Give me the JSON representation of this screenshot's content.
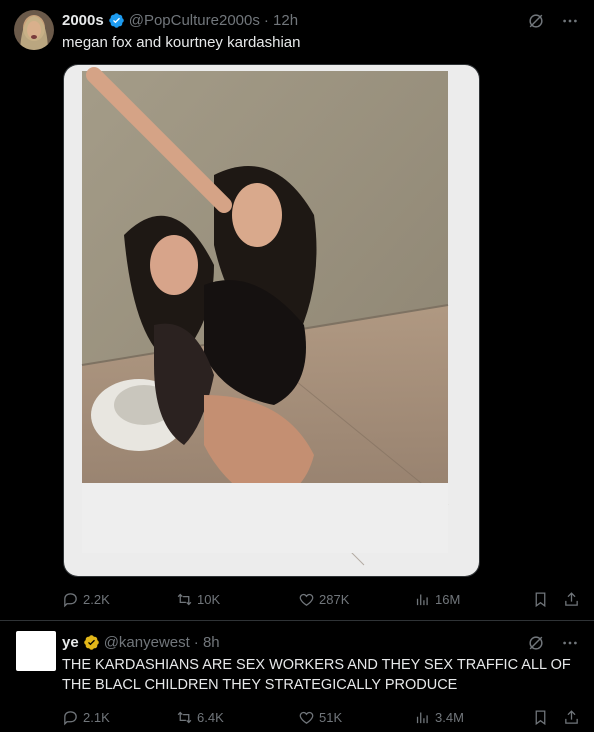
{
  "colors": {
    "background": "#000000",
    "text": "#e7e9ea",
    "muted": "#71767b",
    "verified": "#1d9bf0",
    "verified_gold": "#e2b719",
    "border": "#2f3336"
  },
  "posts": [
    {
      "author": "2000s",
      "handle": "@PopCulture2000s",
      "time": "· 12h",
      "text": "megan fox and kourtney kardashian",
      "badge": "verified-blue-icon",
      "media": "photo",
      "stats": {
        "replies": "2.2K",
        "reposts": "10K",
        "likes": "287K",
        "views": "16M"
      }
    },
    {
      "author": "ye",
      "handle": "@kanyewest",
      "time": "· 8h",
      "text": "THE KARDASHIANS ARE SEX WORKERS AND THEY SEX TRAFFIC ALL OF THE BLACL CHILDREN THEY STRATEGICALLY PRODUCE",
      "badge": "verified-gold-icon",
      "stats": {
        "replies": "2.1K",
        "reposts": "6.4K",
        "likes": "51K",
        "views": "3.4M"
      }
    }
  ],
  "icons": [
    "grok-icon",
    "more-icon",
    "reply-icon",
    "repost-icon",
    "like-icon",
    "views-icon",
    "bookmark-icon",
    "share-icon"
  ]
}
